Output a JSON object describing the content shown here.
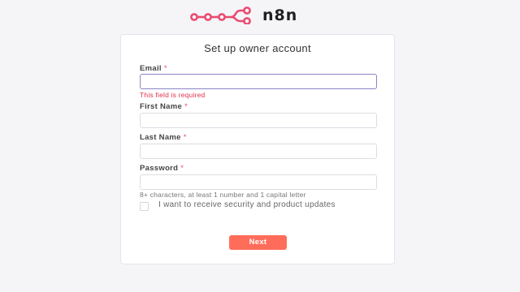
{
  "brand": {
    "name": "n8n",
    "logo_icon": "n8n-logo-icon",
    "logo_color": "#ea4b71"
  },
  "form": {
    "title": "Set up owner account",
    "required_marker": "*",
    "email": {
      "label": "Email",
      "value": "",
      "placeholder": "",
      "error": "This field is required"
    },
    "first_name": {
      "label": "First Name",
      "value": "",
      "placeholder": ""
    },
    "last_name": {
      "label": "Last Name",
      "value": "",
      "placeholder": ""
    },
    "password": {
      "label": "Password",
      "value": "",
      "placeholder": "",
      "hint": "8+ characters, at least 1 number and 1 capital letter"
    },
    "updates_checkbox": {
      "label": "I want to receive security and product updates",
      "checked": false
    },
    "submit_label": "Next"
  },
  "colors": {
    "primary_button": "#ff6d5a",
    "error_text": "#e0304e",
    "required_marker": "#ea4b71",
    "focus_border": "#8a84c9"
  }
}
